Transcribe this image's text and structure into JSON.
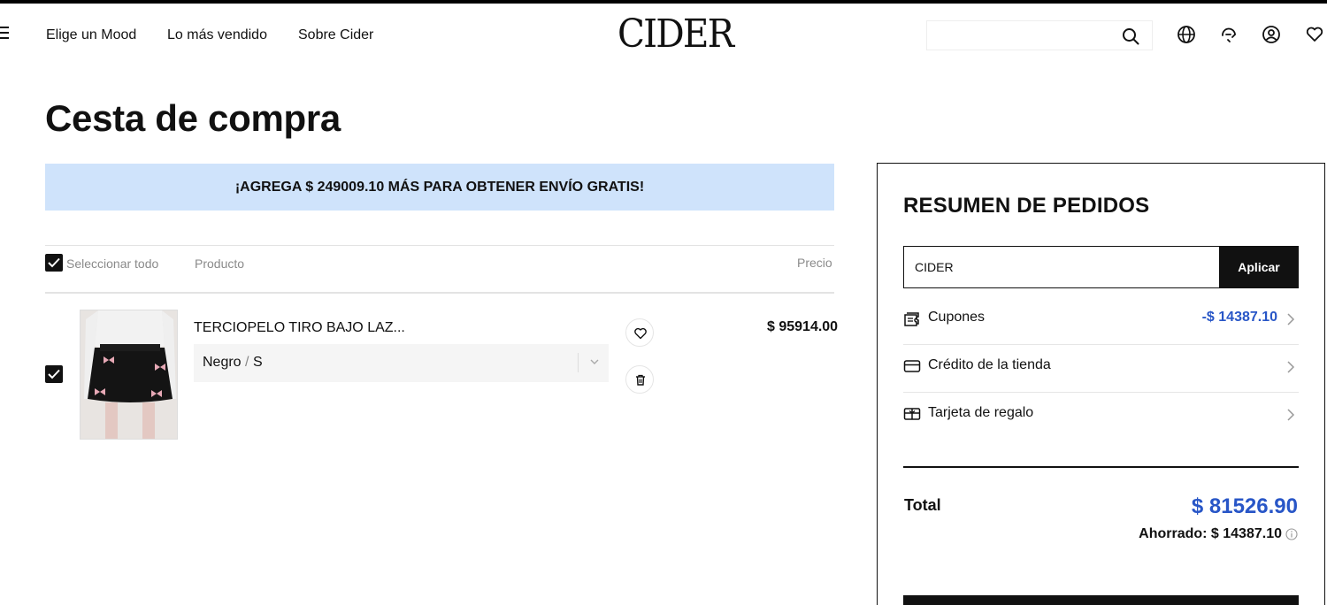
{
  "header": {
    "nav": [
      "Elige un Mood",
      "Lo más vendido",
      "Sobre Cider"
    ],
    "logo": "CIDER",
    "search": {
      "value": "",
      "placeholder": ""
    },
    "icons": [
      "search-icon",
      "globe-icon",
      "support-icon",
      "account-icon",
      "wishlist-icon"
    ]
  },
  "page_title": "Cesta de compra",
  "banner": "¡AGREGA $ 249009.10 MÁS PARA OBTENER ENVÍO GRATIS!",
  "table_header": {
    "select_all": "Seleccionar todo",
    "product": "Producto",
    "price": "Precio"
  },
  "cart_items": [
    {
      "name": "TERCIOPELO TIRO BAJO LAZ...",
      "color": "Negro",
      "separator": "/",
      "size": "S",
      "price": "$ 95914.00",
      "checked": true
    }
  ],
  "summary": {
    "title": "RESUMEN DE PEDIDOS",
    "code_value": "CIDER",
    "apply_label": "Aplicar",
    "rows": [
      {
        "label": "Cupones",
        "value": "-$ 14387.10",
        "icon": "coupon-icon"
      },
      {
        "label": "Crédito de la tienda",
        "value": "",
        "icon": "card-icon"
      },
      {
        "label": "Tarjeta de regalo",
        "value": "",
        "icon": "gift-card-icon"
      }
    ],
    "total_label": "Total",
    "total_value": "$ 81526.90",
    "saved": "Ahorrado: $ 14387.10"
  },
  "colors": {
    "accent_blue": "#2856c7",
    "banner_bg": "#cfe3fb",
    "black": "#111111"
  }
}
